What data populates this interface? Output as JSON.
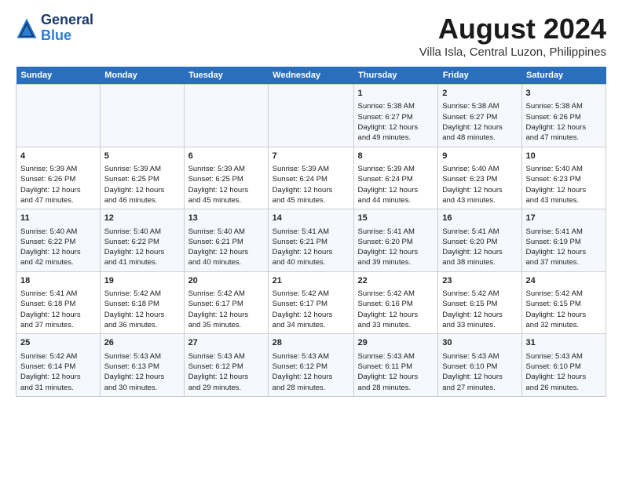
{
  "header": {
    "logo_line1": "General",
    "logo_line2": "Blue",
    "month": "August 2024",
    "location": "Villa Isla, Central Luzon, Philippines"
  },
  "weekdays": [
    "Sunday",
    "Monday",
    "Tuesday",
    "Wednesday",
    "Thursday",
    "Friday",
    "Saturday"
  ],
  "weeks": [
    [
      {
        "day": "",
        "info": ""
      },
      {
        "day": "",
        "info": ""
      },
      {
        "day": "",
        "info": ""
      },
      {
        "day": "",
        "info": ""
      },
      {
        "day": "1",
        "info": "Sunrise: 5:38 AM\nSunset: 6:27 PM\nDaylight: 12 hours\nand 49 minutes."
      },
      {
        "day": "2",
        "info": "Sunrise: 5:38 AM\nSunset: 6:27 PM\nDaylight: 12 hours\nand 48 minutes."
      },
      {
        "day": "3",
        "info": "Sunrise: 5:38 AM\nSunset: 6:26 PM\nDaylight: 12 hours\nand 47 minutes."
      }
    ],
    [
      {
        "day": "4",
        "info": "Sunrise: 5:39 AM\nSunset: 6:26 PM\nDaylight: 12 hours\nand 47 minutes."
      },
      {
        "day": "5",
        "info": "Sunrise: 5:39 AM\nSunset: 6:25 PM\nDaylight: 12 hours\nand 46 minutes."
      },
      {
        "day": "6",
        "info": "Sunrise: 5:39 AM\nSunset: 6:25 PM\nDaylight: 12 hours\nand 45 minutes."
      },
      {
        "day": "7",
        "info": "Sunrise: 5:39 AM\nSunset: 6:24 PM\nDaylight: 12 hours\nand 45 minutes."
      },
      {
        "day": "8",
        "info": "Sunrise: 5:39 AM\nSunset: 6:24 PM\nDaylight: 12 hours\nand 44 minutes."
      },
      {
        "day": "9",
        "info": "Sunrise: 5:40 AM\nSunset: 6:23 PM\nDaylight: 12 hours\nand 43 minutes."
      },
      {
        "day": "10",
        "info": "Sunrise: 5:40 AM\nSunset: 6:23 PM\nDaylight: 12 hours\nand 43 minutes."
      }
    ],
    [
      {
        "day": "11",
        "info": "Sunrise: 5:40 AM\nSunset: 6:22 PM\nDaylight: 12 hours\nand 42 minutes."
      },
      {
        "day": "12",
        "info": "Sunrise: 5:40 AM\nSunset: 6:22 PM\nDaylight: 12 hours\nand 41 minutes."
      },
      {
        "day": "13",
        "info": "Sunrise: 5:40 AM\nSunset: 6:21 PM\nDaylight: 12 hours\nand 40 minutes."
      },
      {
        "day": "14",
        "info": "Sunrise: 5:41 AM\nSunset: 6:21 PM\nDaylight: 12 hours\nand 40 minutes."
      },
      {
        "day": "15",
        "info": "Sunrise: 5:41 AM\nSunset: 6:20 PM\nDaylight: 12 hours\nand 39 minutes."
      },
      {
        "day": "16",
        "info": "Sunrise: 5:41 AM\nSunset: 6:20 PM\nDaylight: 12 hours\nand 38 minutes."
      },
      {
        "day": "17",
        "info": "Sunrise: 5:41 AM\nSunset: 6:19 PM\nDaylight: 12 hours\nand 37 minutes."
      }
    ],
    [
      {
        "day": "18",
        "info": "Sunrise: 5:41 AM\nSunset: 6:18 PM\nDaylight: 12 hours\nand 37 minutes."
      },
      {
        "day": "19",
        "info": "Sunrise: 5:42 AM\nSunset: 6:18 PM\nDaylight: 12 hours\nand 36 minutes."
      },
      {
        "day": "20",
        "info": "Sunrise: 5:42 AM\nSunset: 6:17 PM\nDaylight: 12 hours\nand 35 minutes."
      },
      {
        "day": "21",
        "info": "Sunrise: 5:42 AM\nSunset: 6:17 PM\nDaylight: 12 hours\nand 34 minutes."
      },
      {
        "day": "22",
        "info": "Sunrise: 5:42 AM\nSunset: 6:16 PM\nDaylight: 12 hours\nand 33 minutes."
      },
      {
        "day": "23",
        "info": "Sunrise: 5:42 AM\nSunset: 6:15 PM\nDaylight: 12 hours\nand 33 minutes."
      },
      {
        "day": "24",
        "info": "Sunrise: 5:42 AM\nSunset: 6:15 PM\nDaylight: 12 hours\nand 32 minutes."
      }
    ],
    [
      {
        "day": "25",
        "info": "Sunrise: 5:42 AM\nSunset: 6:14 PM\nDaylight: 12 hours\nand 31 minutes."
      },
      {
        "day": "26",
        "info": "Sunrise: 5:43 AM\nSunset: 6:13 PM\nDaylight: 12 hours\nand 30 minutes."
      },
      {
        "day": "27",
        "info": "Sunrise: 5:43 AM\nSunset: 6:12 PM\nDaylight: 12 hours\nand 29 minutes."
      },
      {
        "day": "28",
        "info": "Sunrise: 5:43 AM\nSunset: 6:12 PM\nDaylight: 12 hours\nand 28 minutes."
      },
      {
        "day": "29",
        "info": "Sunrise: 5:43 AM\nSunset: 6:11 PM\nDaylight: 12 hours\nand 28 minutes."
      },
      {
        "day": "30",
        "info": "Sunrise: 5:43 AM\nSunset: 6:10 PM\nDaylight: 12 hours\nand 27 minutes."
      },
      {
        "day": "31",
        "info": "Sunrise: 5:43 AM\nSunset: 6:10 PM\nDaylight: 12 hours\nand 26 minutes."
      }
    ]
  ]
}
